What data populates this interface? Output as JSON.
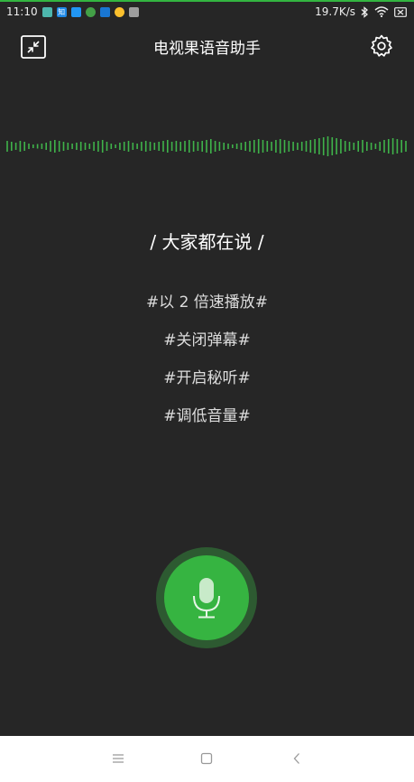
{
  "status_bar": {
    "time": "11:10",
    "network_speed": "19.7K/s",
    "icons": [
      "notification-icon-green",
      "notification-icon-zhihu",
      "notification-icon-blue",
      "notification-icon-circle",
      "notification-icon-book",
      "notification-icon-weather",
      "notification-icon-gray",
      "bluetooth-icon",
      "wifi-icon",
      "battery-icon"
    ],
    "zhihu_glyph": "知"
  },
  "header": {
    "title": "电视果语音助手",
    "left_icon": "minimize-icon",
    "right_icon": "settings-gear-icon"
  },
  "colors": {
    "accent": "#36b441",
    "background": "#262626",
    "wave": "#3fb34a"
  },
  "prompts": {
    "title": "/ 大家都在说 /",
    "items": [
      {
        "label": "#以 2 倍速播放#"
      },
      {
        "label": "#关闭弹幕#"
      },
      {
        "label": "#开启秘听#"
      },
      {
        "label": "#调低音量#"
      }
    ]
  },
  "mic": {
    "icon": "microphone-icon"
  },
  "nav_bar": {
    "buttons": [
      "menu-icon",
      "home-icon",
      "back-icon"
    ]
  }
}
